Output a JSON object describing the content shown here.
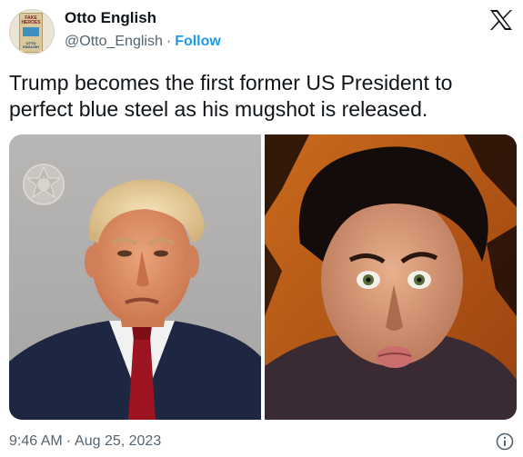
{
  "author": {
    "name": "Otto English",
    "handle": "@Otto_English",
    "separator": "·",
    "follow_label": "Follow",
    "avatar": {
      "book_title": "FAKE HEROES",
      "book_author": "OTTO ENGLISH"
    }
  },
  "tweet": {
    "text": "Trump becomes the first former US President to perfect blue steel as his mugshot is released."
  },
  "media": {
    "images": [
      {
        "name": "mugshot-photo",
        "description_icon": "photo"
      },
      {
        "name": "zoolander-photo",
        "description_icon": "photo"
      }
    ]
  },
  "footer": {
    "time": "9:46 AM",
    "separator": "·",
    "date": "Aug 25, 2023"
  },
  "icons": {
    "platform_logo": "x-logo-icon",
    "info": "info-icon"
  },
  "colors": {
    "text": "#0f1419",
    "secondary": "#536471",
    "link": "#1d9bf0",
    "background": "#ffffff"
  }
}
